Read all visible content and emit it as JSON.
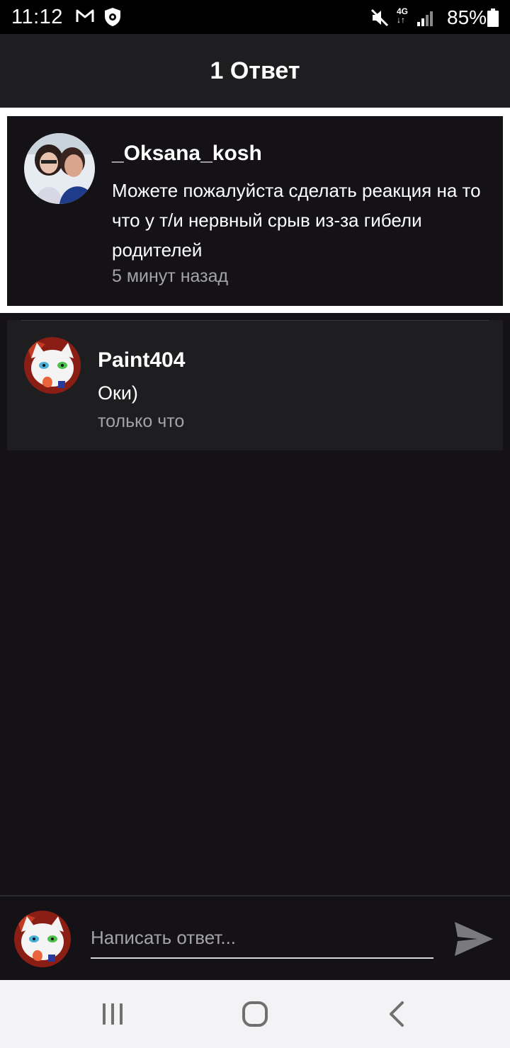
{
  "status_bar": {
    "time": "11:12",
    "network": "4G",
    "battery": "85%",
    "icons": [
      "gmail-icon",
      "shield-app-icon",
      "mute-icon",
      "signal-icon",
      "battery-icon"
    ]
  },
  "header": {
    "title": "1 Ответ"
  },
  "original_comment": {
    "username": "_Oksana_kosh",
    "text": "Можете пожалуйста сделать реакция на то что у т/и нервный срыв из-за гибели родителей",
    "time": "5 минут назад"
  },
  "reply": {
    "username": "Paint404",
    "text": "Оки)",
    "time": "только что"
  },
  "composer": {
    "placeholder": "Написать ответ...",
    "value": ""
  },
  "nav": {
    "icons": [
      "recents-icon",
      "home-icon",
      "back-icon"
    ]
  },
  "colors": {
    "background": "#141216",
    "header": "#1e1d20",
    "reply_card": "#1e1d20",
    "muted_text": "#a4a3a6",
    "highlight_border": "#ffffff",
    "nav_bar": "#f3f2f4"
  }
}
